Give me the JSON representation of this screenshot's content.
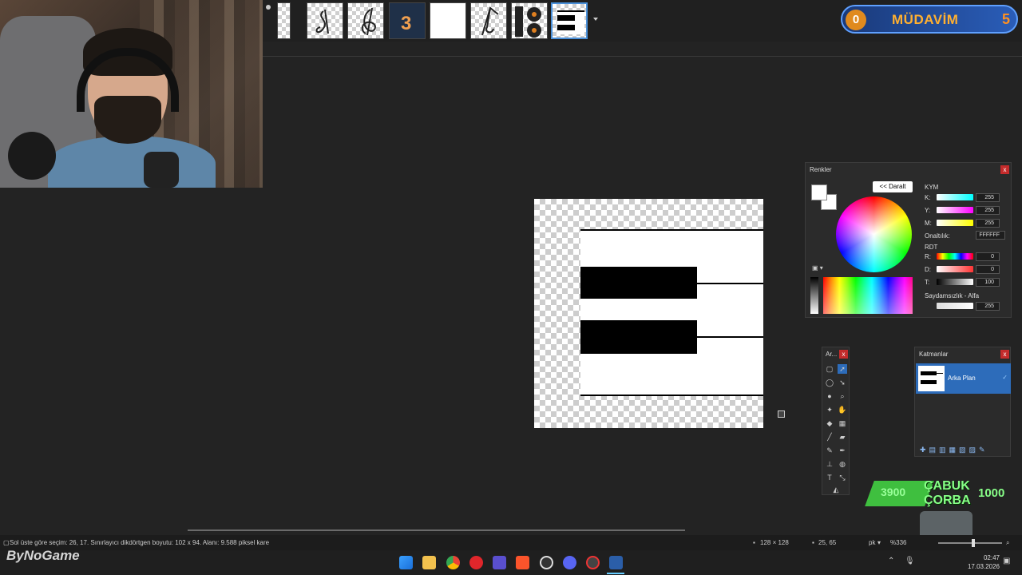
{
  "badge": {
    "level": "0",
    "title": "MÜDAVİM",
    "count": "5"
  },
  "tabs": [
    {
      "name": "tab-partial"
    },
    {
      "name": "tab-1"
    },
    {
      "name": "tab-2"
    },
    {
      "name": "tab-3"
    },
    {
      "name": "tab-4"
    },
    {
      "name": "tab-5"
    },
    {
      "name": "tab-6"
    },
    {
      "name": "tab-7-active"
    }
  ],
  "colors_panel": {
    "title": "Renkler",
    "collapse_label": "<< Daralt",
    "cmy_header": "KYM",
    "k_label": "K:",
    "k_value": "255",
    "y_label": "Y:",
    "y_value": "255",
    "m_label": "M:",
    "m_value": "255",
    "hex_label": "Onaltılık:",
    "hex_value": "FFFFFF",
    "hsv_header": "RDT",
    "r_label": "R:",
    "r_value": "0",
    "d_label": "D:",
    "d_value": "0",
    "t_label": "T:",
    "t_value": "100",
    "alpha_label": "Saydamsızlık - Alfa",
    "alpha_value": "255"
  },
  "tools_panel": {
    "title": "Ar..."
  },
  "layers_panel": {
    "title": "Katmanlar",
    "layer_name": "Arka Plan"
  },
  "status": {
    "selection_info": "Sol üste göre seçim: 26, 17. Sınırlayıcı dikdörtgen boyutu: 102 x 94. Alanı: 9.588 piksel kare",
    "image_size": "128 × 128",
    "cursor_pos": "25, 65",
    "unit": "pk",
    "zoom": "%336"
  },
  "overlay": {
    "chip_value": "3900",
    "chip_line1": "ÇABUK",
    "chip_line2": "ÇORBA",
    "chip_count": "1000"
  },
  "watermark": "ByNoGame",
  "clock": {
    "time": "02:47",
    "date": "17.03.2026"
  }
}
